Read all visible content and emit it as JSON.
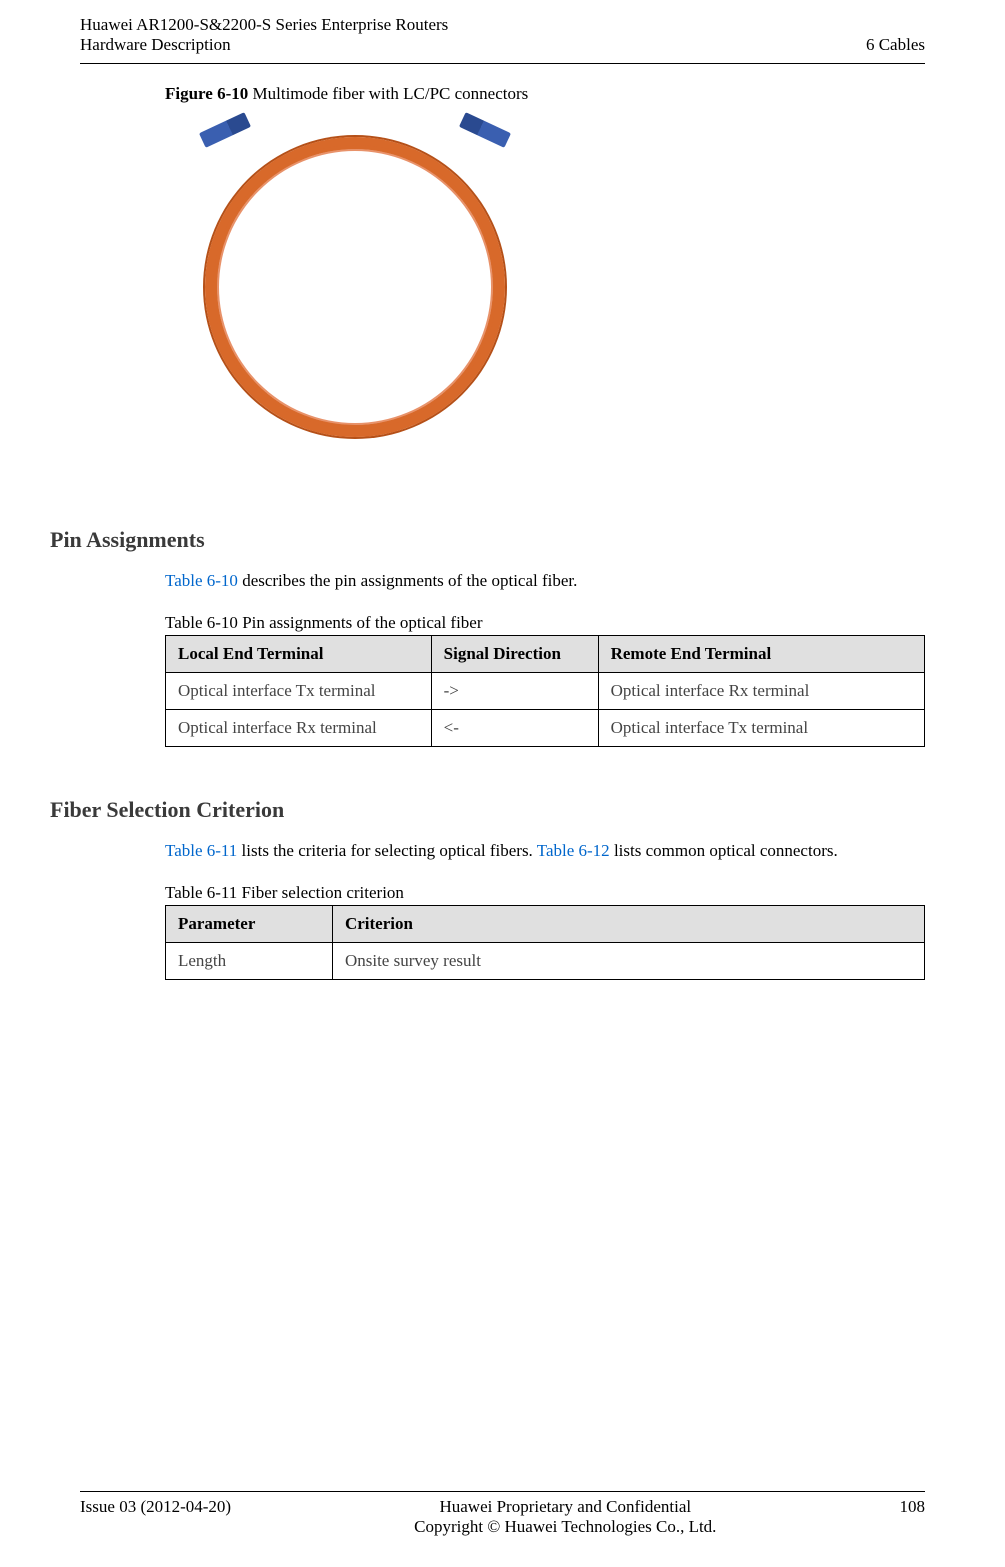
{
  "header": {
    "line1": "Huawei AR1200-S&2200-S Series Enterprise Routers",
    "line2": "Hardware Description",
    "right": "6 Cables"
  },
  "figure": {
    "label": "Figure 6-10",
    "caption": " Multimode fiber with LC/PC connectors"
  },
  "section1": {
    "heading": "Pin Assignments",
    "body_link": "Table 6-10",
    "body_rest": " describes the pin assignments of the optical fiber.",
    "table_caption_label": "Table 6-10",
    "table_caption_rest": " Pin assignments of the optical fiber",
    "table": {
      "headers": [
        "Local End Terminal",
        "Signal Direction",
        "Remote End Terminal"
      ],
      "rows": [
        [
          "Optical interface Tx terminal",
          "->",
          "Optical interface Rx terminal"
        ],
        [
          "Optical interface Rx terminal",
          "<-",
          "Optical interface Tx terminal"
        ]
      ]
    }
  },
  "section2": {
    "heading": "Fiber Selection Criterion",
    "body_link1": "Table 6-11",
    "body_mid": " lists the criteria for selecting optical fibers. ",
    "body_link2": "Table 6-12",
    "body_end": " lists common optical connectors.",
    "table_caption_label": "Table 6-11",
    "table_caption_rest": " Fiber selection criterion",
    "table": {
      "headers": [
        "Parameter",
        "Criterion"
      ],
      "rows": [
        [
          "Length",
          "Onsite survey result"
        ]
      ]
    }
  },
  "footer": {
    "left": "Issue 03 (2012-04-20)",
    "center1": "Huawei Proprietary and Confidential",
    "center2": "Copyright © Huawei Technologies Co., Ltd.",
    "right": "108"
  }
}
